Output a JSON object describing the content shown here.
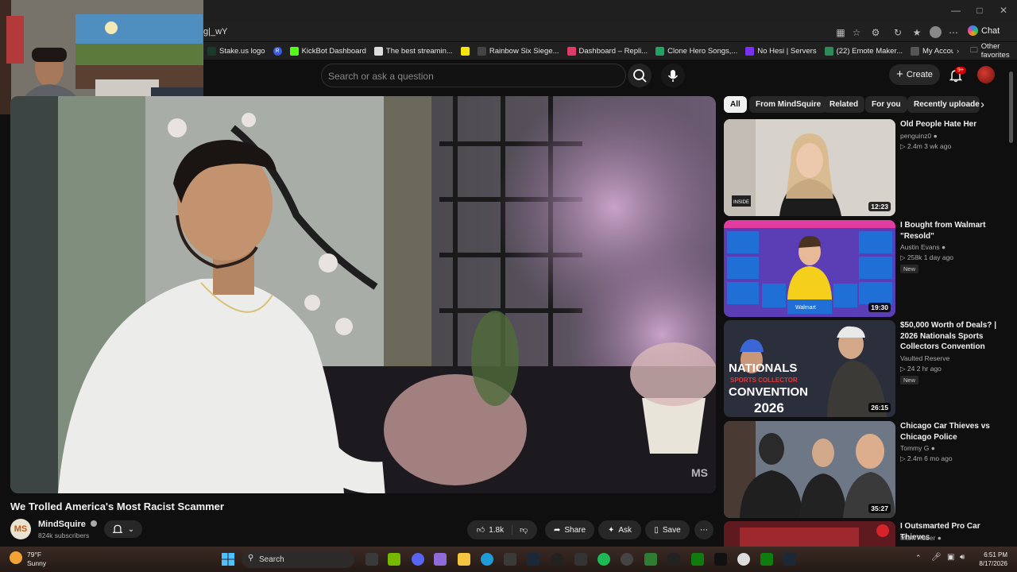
{
  "browser": {
    "url_fragment": "g|_wY",
    "chat_label": "Chat",
    "bookmarks": [
      {
        "label": "Stake.us logo",
        "color": "#1a3a2a"
      },
      {
        "label": "",
        "color": "#3b5bdb",
        "letter": "R"
      },
      {
        "label": "KickBot Dashboard",
        "color": "#53fc18"
      },
      {
        "label": "The best streamin...",
        "color": "#dddddd"
      },
      {
        "label": "",
        "color": "#f5e50d"
      },
      {
        "label": "Rainbow Six Siege...",
        "color": "#444444"
      },
      {
        "label": "Dashboard – Repli...",
        "color": "#e03a66"
      },
      {
        "label": "Clone Hero Songs,...",
        "color": "#20a464"
      },
      {
        "label": "No Hesi | Servers",
        "color": "#7b2ff7"
      },
      {
        "label": "(22) Emote Maker...",
        "color": "#2e8b57"
      },
      {
        "label": "My Account | Palm...",
        "color": "#555555"
      }
    ],
    "other_favorites": "Other favorites"
  },
  "header": {
    "search_placeholder": "Search or ask a question",
    "create_label": "Create",
    "notifications_badge": "9+"
  },
  "video": {
    "title": "We Trolled America's Most Racist Scammer",
    "watermark": "MS",
    "channel": {
      "name": "MindSquire",
      "initials": "MS",
      "subscribers": "824k subscribers"
    },
    "actions": {
      "likes": "1.8k",
      "share": "Share",
      "ask": "Ask",
      "save": "Save"
    }
  },
  "chips": [
    "All",
    "From MindSquire",
    "Related",
    "For you",
    "Recently uploade"
  ],
  "recommendations": [
    {
      "title_lines": [
        "Old People Hate Her"
      ],
      "channel": "penguinz0",
      "meta": "2.4m   3 wk ago",
      "duration": "12:23",
      "new": "",
      "thumb_label": "INSIDE"
    },
    {
      "title_lines": [
        "I Bought from Walmart",
        "\"Resold\""
      ],
      "channel": "Austin Evans",
      "meta": "258k   1 day ago",
      "duration": "19:30",
      "new": "New",
      "thumb_label": "Walmart"
    },
    {
      "title_lines": [
        "$50,000 Worth of Deals? |",
        "2026 Nationals Sports",
        "Collectors Convention"
      ],
      "channel": "Vaulted Reserve",
      "meta": "24   2 hr ago",
      "duration": "26:15",
      "new": "New",
      "thumb_label": "NATIONALS",
      "thumb_sub": "SPORTS COLLECTOR",
      "thumb_sub2": "CONVENTION",
      "thumb_year": "2026"
    },
    {
      "title_lines": [
        "Chicago Car Thieves vs",
        "Chicago Police"
      ],
      "channel": "Tommy G",
      "meta": "2.4m   6 mo ago",
      "duration": "35:27",
      "new": ""
    },
    {
      "title_lines": [
        "I Outsmarted Pro Car Thieves"
      ],
      "channel": "Mark Rober",
      "meta": "",
      "duration": "",
      "new": ""
    }
  ],
  "taskbar": {
    "weather_temp": "79°F",
    "weather_desc": "Sunny",
    "search_label": "Search",
    "time": "6:51 PM",
    "date": "8/17/2026"
  }
}
